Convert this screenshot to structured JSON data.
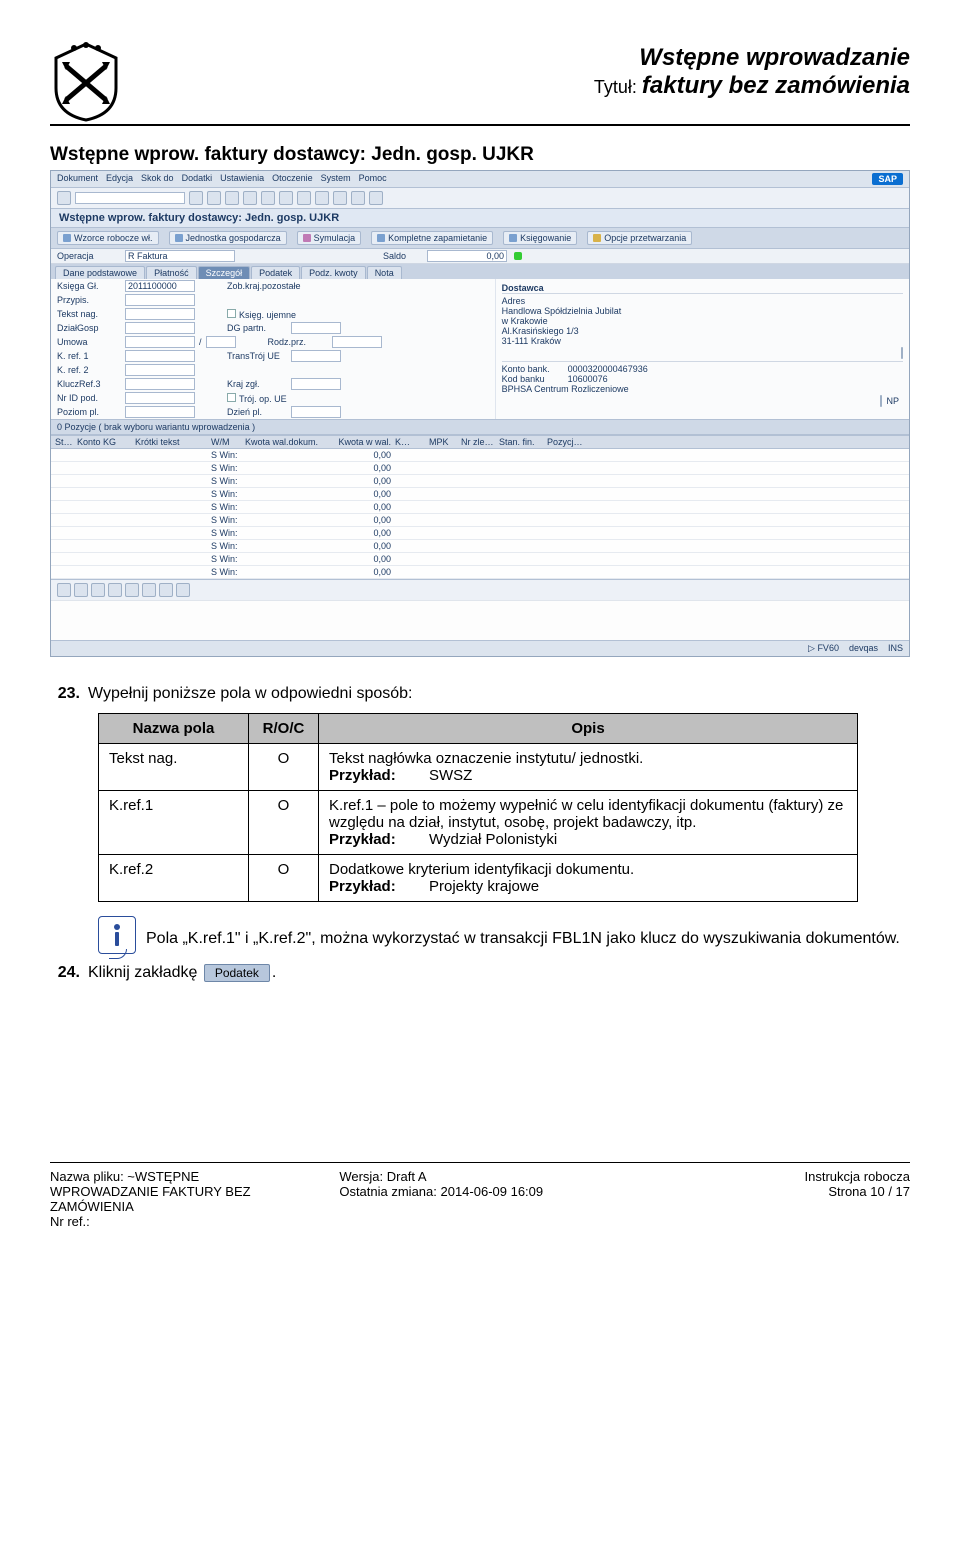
{
  "header": {
    "line1": "Wstępne wprowadzanie",
    "tytul_label": "Tytuł:",
    "line2_bold": "faktury bez zamówienia"
  },
  "section_heading": "Wstępne wprow. faktury dostawcy: Jedn. gosp. UJKR",
  "sap": {
    "menu": [
      "Dokument",
      "Edycja",
      "Skok do",
      "Dodatki",
      "Ustawienia",
      "Otoczenie",
      "System",
      "Pomoc"
    ],
    "inner_title": "Wstępne wprow. faktury dostawcy: Jedn. gosp. UJKR",
    "appbar": [
      "Wzorce robocze wł.",
      "Jednostka gospodarcza",
      "Symulacja",
      "Kompletne zapamietanie",
      "Księgowanie",
      "Opcje przetwarzania"
    ],
    "operacja_label": "Operacja",
    "operacja_value": "R Faktura",
    "saldo_label": "Saldo",
    "saldo_value": "0,00",
    "tabs": [
      "Dane podstawowe",
      "Płatność",
      "Szczegół",
      "Podatek",
      "Podz. kwoty",
      "Nota"
    ],
    "left_fields": [
      {
        "label": "Księga Gł.",
        "value": "2011100000",
        "extra": "Zob.kraj.pozostałe"
      },
      {
        "label": "Przypis.",
        "value": ""
      },
      {
        "label": "Tekst nag.",
        "value": "",
        "extra_cb": "Księg. ujemne"
      },
      {
        "label": "DziałGosp",
        "value": "",
        "extra_lbl": "DG partn."
      },
      {
        "label": "Umowa",
        "value": "",
        "sep": "/",
        "extra_lbl": "Rodz.prz."
      },
      {
        "label": "K. ref. 1",
        "value": "",
        "extra_lbl": "TransTrój UE"
      },
      {
        "label": "K. ref. 2",
        "value": ""
      },
      {
        "label": "KluczRef.3",
        "value": "",
        "extra_lbl": "Kraj zgł."
      },
      {
        "label": "Nr ID pod.",
        "value": "",
        "extra_cb": "Trój. op. UE"
      },
      {
        "label": "Poziom pl.",
        "value": "",
        "extra_lbl": "Dzień pl."
      }
    ],
    "right_header": "Dostawca",
    "right_addr": [
      "Adres",
      "Handlowa Spółdzielnia Jubilat",
      "w Krakowie",
      "Al.Krasińskiego 1/3",
      "31-111 Kraków"
    ],
    "right_fields": [
      {
        "label": "Konto bank.",
        "value": "0000320000467936"
      },
      {
        "label": "Kod banku",
        "value": "10600076"
      }
    ],
    "right_bank": "BPHSA Centrum Rozliczeniowe",
    "positions_caption": "0 Pozycje ( brak wyboru wariantu wprowadzenia )",
    "grid_cols": [
      "St…",
      "Konto KG",
      "Krótki tekst",
      "W/M",
      "Kwota wal.dokum.",
      "Kwota w wal.",
      "K…",
      "MPK",
      "Nr zle…",
      "Stan. fin.",
      "Pozycj…"
    ],
    "grid_rows_count": 10,
    "grid_wm": "S Win:",
    "grid_kwota": "0,00",
    "status": [
      "FV60",
      "devqas",
      "INS"
    ],
    "sap_logo": "SAP"
  },
  "steps": {
    "s23_num": "23.",
    "s23_text": "Wypełnij poniższe pola w odpowiedni sposób:",
    "s24_num": "24.",
    "s24_text_a": "Kliknij zakładkę ",
    "s24_text_b": "."
  },
  "table": {
    "h1": "Nazwa pola",
    "h2": "R/O/C",
    "h3": "Opis",
    "r1": {
      "c1": "Tekst nag.",
      "c2": "O",
      "desc": "Tekst nagłówka oznaczenie instytutu/ jednostki.",
      "ex_lbl": "Przykład:",
      "ex_val": "SWSZ"
    },
    "r2": {
      "c1": "K.ref.1",
      "c2": "O",
      "desc": "K.ref.1 – pole to możemy wypełnić w celu identyfikacji dokumentu (faktury) ze względu na dział, instytut, osobę, projekt badawczy, itp.",
      "ex_lbl": "Przykład:",
      "ex_val": "Wydział Polonistyki"
    },
    "r3": {
      "c1": "K.ref.2",
      "c2": "O",
      "desc": "Dodatkowe kryterium identyfikacji dokumentu.",
      "ex_lbl": "Przykład:",
      "ex_val": "Projekty krajowe"
    }
  },
  "info": {
    "text_a": "Pola „K.ref.1\" i „K.ref.2\", można wykorzystać w transakcji FBL1N jako klucz do wyszukiwania dokumentów."
  },
  "podatek_label": "Podatek",
  "footer": {
    "l1": "Nazwa pliku: ~WSTĘPNE",
    "l2": "WPROWADZANIE FAKTURY BEZ",
    "l3": "ZAMÓWIENIA",
    "l4": "Nr ref.:",
    "m1": "Wersja: Draft A",
    "m2": "Ostatnia zmiana: 2014-06-09 16:09",
    "r1": "Instrukcja robocza",
    "r2": "Strona 10 / 17"
  }
}
